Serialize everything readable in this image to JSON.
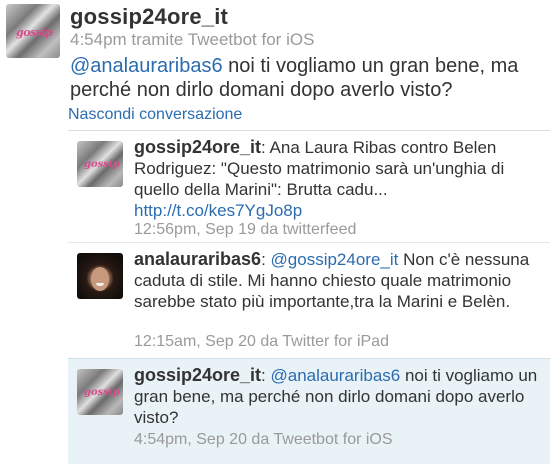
{
  "main_tweet": {
    "username": "gossip24ore_it",
    "meta": "4:54pm tramite Tweetbot for iOS",
    "mention": "@analauraribas6",
    "text": " noi ti vogliamo un gran bene, ma perché non dirlo domani dopo averlo visto?"
  },
  "hide_conversation_label": "Nascondi conversazione",
  "thread": [
    {
      "username": "gossip24ore_it",
      "text": ": Ana Laura Ribas contro Belen Rodriguez: \"Questo matrimonio sarà un'unghia di quello della Marini\": Brutta cadu...",
      "link": "http://t.co/kes7YgJo8p",
      "meta": "12:56pm, Sep 19 da twitterfeed"
    },
    {
      "username": "analauraribas6",
      "mention": "@gossip24ore_it",
      "text_before": ": ",
      "text": " Non c'è nessuna caduta di stile. Mi hanno chiesto quale matrimonio sarebbe stato più importante,tra la Marini e Belèn.",
      "meta": "12:15am, Sep 20 da Twitter for iPad"
    },
    {
      "username": "gossip24ore_it",
      "mention": "@analauraribas6",
      "text_before": ": ",
      "text": " noi ti vogliamo un gran bene, ma perché non dirlo domani dopo averlo visto?",
      "meta": "4:54pm, Sep 20 da Tweetbot for iOS"
    }
  ],
  "colors": {
    "link": "#2b6cb0",
    "meta": "#9a9a9a",
    "highlight": "#e8f2f7"
  }
}
